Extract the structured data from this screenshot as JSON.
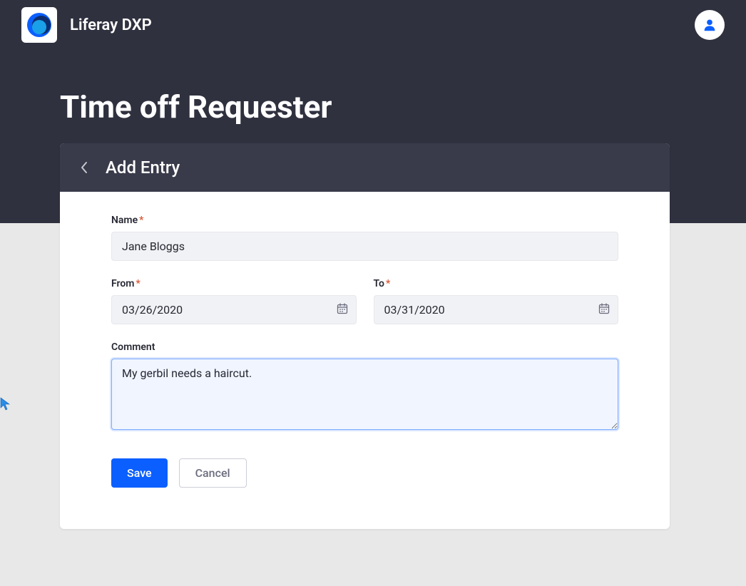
{
  "brand": "Liferay DXP",
  "page_title": "Time off Requester",
  "card_title": "Add Entry",
  "fields": {
    "name": {
      "label": "Name",
      "value": "Jane Bloggs"
    },
    "from": {
      "label": "From",
      "value": "03/26/2020"
    },
    "to": {
      "label": "To",
      "value": "03/31/2020"
    },
    "comment": {
      "label": "Comment",
      "value": "My gerbil needs a haircut."
    }
  },
  "required_mark": "*",
  "buttons": {
    "save": "Save",
    "cancel": "Cancel"
  }
}
